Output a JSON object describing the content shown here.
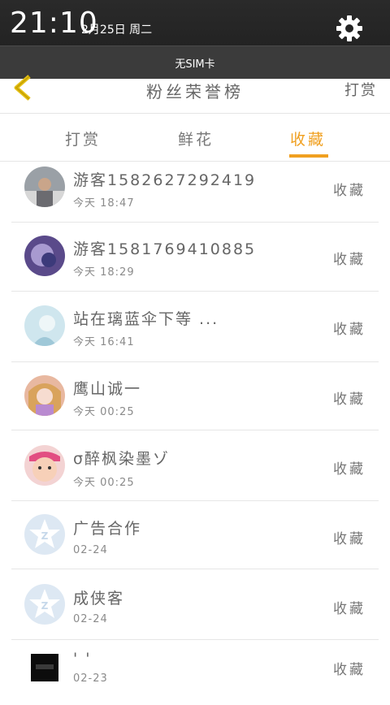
{
  "status_bar": {
    "time": "21:10",
    "date": "2月25日 周二",
    "sim_status": "无SIM卡"
  },
  "header": {
    "title": "粉丝荣誉榜",
    "right_action": "打赏"
  },
  "tabs": [
    {
      "label": "打赏",
      "active": false
    },
    {
      "label": "鲜花",
      "active": false
    },
    {
      "label": "收藏",
      "active": true
    }
  ],
  "colors": {
    "accent": "#f0a020",
    "text": "#666666",
    "status_bg": "#2a2a2a"
  },
  "fans": [
    {
      "name": "游客1582627292419",
      "time": "今天 18:47",
      "action": "收藏",
      "avatar": "photo-man"
    },
    {
      "name": "游客1581769410885",
      "time": "今天 18:29",
      "action": "收藏",
      "avatar": "anime-purple"
    },
    {
      "name": "站在璃蓝伞下等 ...",
      "time": "今天 16:41",
      "action": "收藏",
      "avatar": "anime-blue"
    },
    {
      "name": "鹰山诚一",
      "time": "今天 00:25",
      "action": "收藏",
      "avatar": "anime-pink"
    },
    {
      "name": "σ醉枫染墨ゾ",
      "time": "今天 00:25",
      "action": "收藏",
      "avatar": "photo-baby"
    },
    {
      "name": "广告合作",
      "time": "02-24",
      "action": "收藏",
      "avatar": "default-icon"
    },
    {
      "name": "成侠客",
      "time": "02-24",
      "action": "收藏",
      "avatar": "default-icon"
    },
    {
      "name": "' '",
      "time": "02-23",
      "action": "收藏",
      "avatar": "dark-logo"
    }
  ]
}
